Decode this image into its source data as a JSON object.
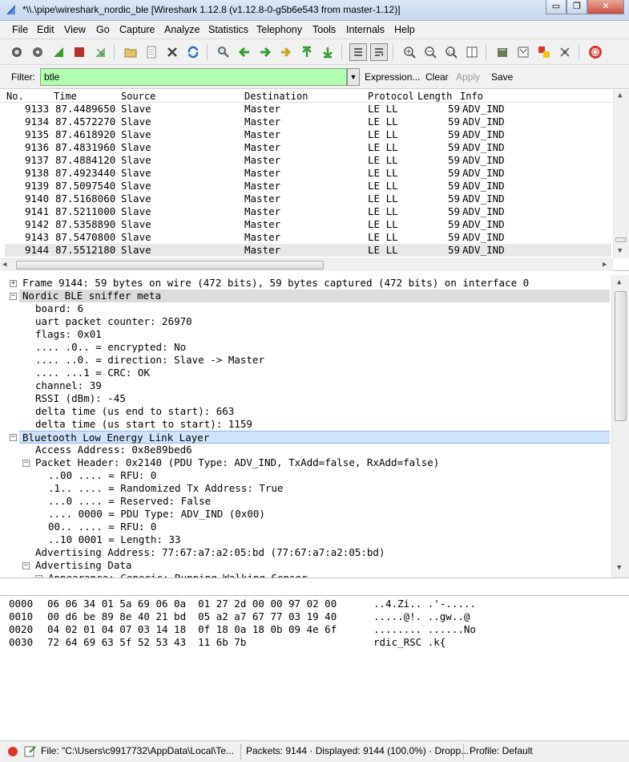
{
  "window": {
    "title": "*\\\\.\\pipe\\wireshark_nordic_ble   [Wireshark 1.12.8  (v1.12.8-0-g5b6e543 from master-1.12)]",
    "minimize": "▭",
    "restore": "❐",
    "close": "✕"
  },
  "menu": [
    "File",
    "Edit",
    "View",
    "Go",
    "Capture",
    "Analyze",
    "Statistics",
    "Telephony",
    "Tools",
    "Internals",
    "Help"
  ],
  "toolbar_icons": [
    "interfaces-icon",
    "options-icon",
    "start-capture-icon",
    "stop-capture-icon",
    "restart-capture-icon",
    "open-file-icon",
    "save-file-icon",
    "close-file-icon",
    "reload-icon",
    "find-packet-icon",
    "go-back-icon",
    "go-forward-icon",
    "go-to-packet-icon",
    "go-first-icon",
    "go-last-icon",
    "colorize-icon",
    "autoscroll-icon",
    "zoom-in-icon",
    "zoom-out-icon",
    "zoom-normal-icon",
    "resize-columns-icon",
    "capture-filters-icon",
    "display-filters-icon",
    "coloring-rules-icon",
    "preferences-icon",
    "help-icon"
  ],
  "filter": {
    "label": "Filter:",
    "value": "btle",
    "expression": "Expression...",
    "clear": "Clear",
    "apply": "Apply",
    "save": "Save"
  },
  "packet_list": {
    "columns": [
      "No.",
      "Time",
      "Source",
      "Destination",
      "Protocol",
      "Length",
      "Info"
    ],
    "rows": [
      {
        "no": "9133",
        "time": "87.4489650",
        "src": "Slave",
        "dst": "Master",
        "proto": "LE LL",
        "len": "59",
        "info": "ADV_IND"
      },
      {
        "no": "9134",
        "time": "87.4572270",
        "src": "Slave",
        "dst": "Master",
        "proto": "LE LL",
        "len": "59",
        "info": "ADV_IND"
      },
      {
        "no": "9135",
        "time": "87.4618920",
        "src": "Slave",
        "dst": "Master",
        "proto": "LE LL",
        "len": "59",
        "info": "ADV_IND"
      },
      {
        "no": "9136",
        "time": "87.4831960",
        "src": "Slave",
        "dst": "Master",
        "proto": "LE LL",
        "len": "59",
        "info": "ADV_IND"
      },
      {
        "no": "9137",
        "time": "87.4884120",
        "src": "Slave",
        "dst": "Master",
        "proto": "LE LL",
        "len": "59",
        "info": "ADV_IND"
      },
      {
        "no": "9138",
        "time": "87.4923440",
        "src": "Slave",
        "dst": "Master",
        "proto": "LE LL",
        "len": "59",
        "info": "ADV_IND"
      },
      {
        "no": "9139",
        "time": "87.5097540",
        "src": "Slave",
        "dst": "Master",
        "proto": "LE LL",
        "len": "59",
        "info": "ADV_IND"
      },
      {
        "no": "9140",
        "time": "87.5168060",
        "src": "Slave",
        "dst": "Master",
        "proto": "LE LL",
        "len": "59",
        "info": "ADV_IND"
      },
      {
        "no": "9141",
        "time": "87.5211000",
        "src": "Slave",
        "dst": "Master",
        "proto": "LE LL",
        "len": "59",
        "info": "ADV_IND"
      },
      {
        "no": "9142",
        "time": "87.5358890",
        "src": "Slave",
        "dst": "Master",
        "proto": "LE LL",
        "len": "59",
        "info": "ADV_IND"
      },
      {
        "no": "9143",
        "time": "87.5470800",
        "src": "Slave",
        "dst": "Master",
        "proto": "LE LL",
        "len": "59",
        "info": "ADV_IND"
      },
      {
        "no": "9144",
        "time": "87.5512180",
        "src": "Slave",
        "dst": "Master",
        "proto": "LE LL",
        "len": "59",
        "info": "ADV_IND"
      }
    ]
  },
  "details": [
    {
      "text": "Frame 9144: 59 bytes on wire (472 bits), 59 bytes captured (472 bits) on interface 0",
      "toggle": "+",
      "level": 0,
      "style": "normal"
    },
    {
      "text": "Nordic BLE sniffer meta",
      "toggle": "−",
      "level": 0,
      "style": "hl"
    },
    {
      "text": "board: 6",
      "toggle": "",
      "level": 1,
      "style": "normal"
    },
    {
      "text": "uart packet counter: 26970",
      "toggle": "",
      "level": 1,
      "style": "normal"
    },
    {
      "text": "flags: 0x01",
      "toggle": "",
      "level": 1,
      "style": "normal"
    },
    {
      "text": ".... .0.. = encrypted: No",
      "toggle": "",
      "level": 1,
      "style": "normal"
    },
    {
      "text": ".... ..0. = direction: Slave -> Master",
      "toggle": "",
      "level": 1,
      "style": "normal"
    },
    {
      "text": ".... ...1 = CRC: OK",
      "toggle": "",
      "level": 1,
      "style": "normal"
    },
    {
      "text": "channel: 39",
      "toggle": "",
      "level": 1,
      "style": "normal"
    },
    {
      "text": "RSSI (dBm): -45",
      "toggle": "",
      "level": 1,
      "style": "normal"
    },
    {
      "text": "delta time (us end to start): 663",
      "toggle": "",
      "level": 1,
      "style": "normal"
    },
    {
      "text": "delta time (us start to start): 1159",
      "toggle": "",
      "level": 1,
      "style": "normal"
    },
    {
      "text": "Bluetooth Low Energy Link Layer",
      "toggle": "−",
      "level": 0,
      "style": "sel"
    },
    {
      "text": "Access Address: 0x8e89bed6",
      "toggle": "",
      "level": 1,
      "style": "normal"
    },
    {
      "text": "Packet Header: 0x2140 (PDU Type: ADV_IND, TxAdd=false, RxAdd=false)",
      "toggle": "−",
      "level": 1,
      "style": "normal"
    },
    {
      "text": "..00 .... = RFU: 0",
      "toggle": "",
      "level": 2,
      "style": "normal"
    },
    {
      "text": ".1.. .... = Randomized Tx Address: True",
      "toggle": "",
      "level": 2,
      "style": "normal"
    },
    {
      "text": "...0 .... = Reserved: False",
      "toggle": "",
      "level": 2,
      "style": "normal"
    },
    {
      "text": ".... 0000 = PDU Type: ADV_IND (0x00)",
      "toggle": "",
      "level": 2,
      "style": "normal"
    },
    {
      "text": "00.. .... = RFU: 0",
      "toggle": "",
      "level": 2,
      "style": "normal"
    },
    {
      "text": "..10 0001 = Length: 33",
      "toggle": "",
      "level": 2,
      "style": "normal"
    },
    {
      "text": "Advertising Address: 77:67:a7:a2:05:bd (77:67:a7:a2:05:bd)",
      "toggle": "",
      "level": 1,
      "style": "normal"
    },
    {
      "text": "Advertising Data",
      "toggle": "−",
      "level": 1,
      "style": "normal"
    },
    {
      "text": "Appearance: Generic: Running Walking Sensor",
      "toggle": "−",
      "level": 2,
      "style": "normal"
    }
  ],
  "bytes": [
    {
      "offset": "0000",
      "hex": "06 06 34 01 5a 69 06 0a  01 27 2d 00 00 97 02 00",
      "ascii": "..4.Zi.. .'-....."
    },
    {
      "offset": "0010",
      "hex": "00 d6 be 89 8e 40 21 bd  05 a2 a7 67 77 03 19 40",
      "ascii": ".....@!. ..gw..@"
    },
    {
      "offset": "0020",
      "hex": "04 02 01 04 07 03 14 18  0f 18 0a 18 0b 09 4e 6f",
      "ascii": "........ ......No"
    },
    {
      "offset": "0030",
      "hex": "72 64 69 63 5f 52 53 43  11 6b 7b",
      "ascii": "rdic_RSC .k{"
    }
  ],
  "status": {
    "file": "File: \"C:\\Users\\c9917732\\AppData\\Local\\Te...",
    "packets": "Packets: 9144 · Displayed: 9144 (100.0%) · Dropp...",
    "profile": "Profile: Default"
  }
}
